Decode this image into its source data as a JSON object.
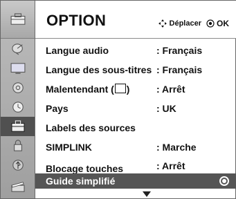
{
  "header": {
    "title": "OPTION",
    "move_label": "Déplacer",
    "ok_label": "OK",
    "move_icon": "four-way-arrow-icon",
    "ok_icon": "ok-button-icon"
  },
  "sidebar": {
    "icons": [
      "option-toolbox-icon",
      "satellite-dish-icon",
      "tv-screen-icon",
      "audio-disc-icon",
      "clock-icon",
      "option-toolbox-icon",
      "lock-icon",
      "usb-icon",
      "clapperboard-icon"
    ]
  },
  "menu": {
    "items": [
      {
        "label": "Langue audio",
        "value": ": Français"
      },
      {
        "label": "Langue des sous-titres",
        "value": ": Français"
      },
      {
        "label_pre": "Malentendant (",
        "label_post": ")",
        "value": ": Arrêt"
      },
      {
        "label": "Pays",
        "value": ": UK"
      },
      {
        "label": "Labels des sources",
        "value": ""
      },
      {
        "label": "SIMPLINK",
        "value": ": Marche"
      },
      {
        "label": "Blocage touches",
        "value": ": Arrêt"
      },
      {
        "label": "Guide simplifié",
        "value": ""
      }
    ],
    "selected_index": 7
  },
  "colors": {
    "selected_row": "#555555",
    "sidebar": "#a8a8a8"
  }
}
